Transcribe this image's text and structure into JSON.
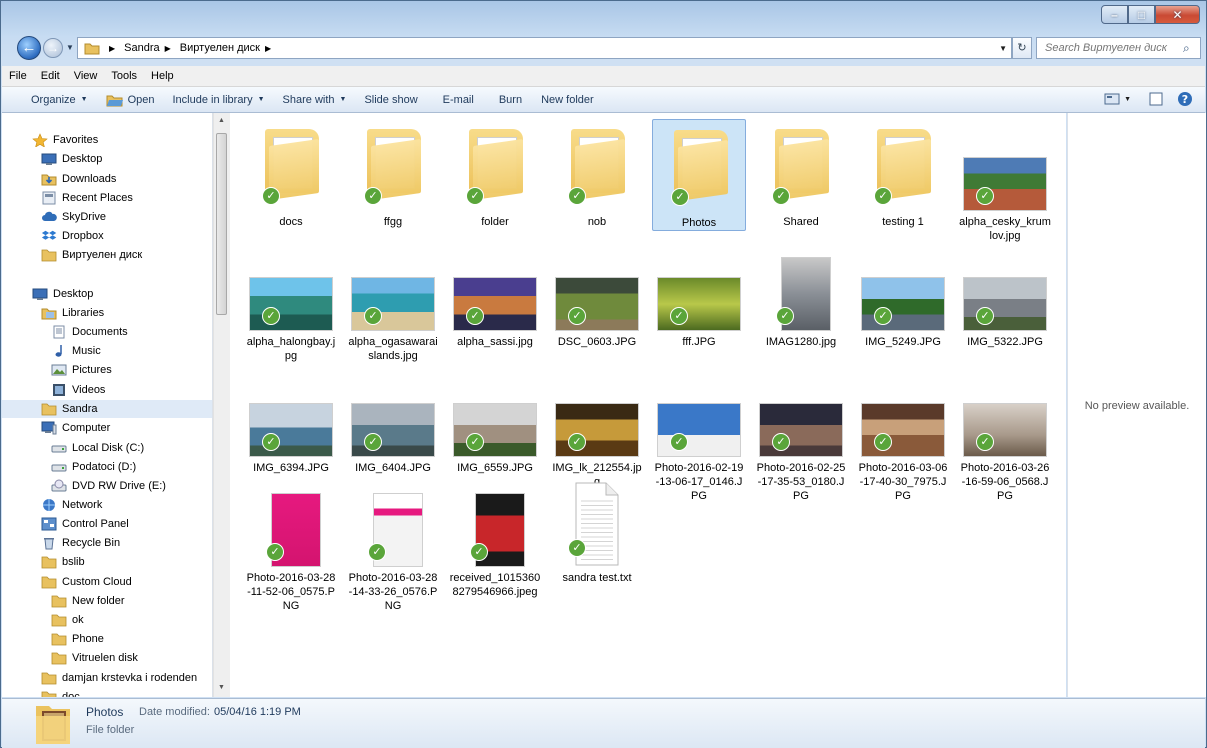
{
  "window": {
    "minimize_label": "–",
    "maximize_label": "□",
    "close_label": "✕"
  },
  "address": {
    "crumbs": [
      "Sandra",
      "Виртуелен диск"
    ],
    "search_placeholder": "Search Виртуелен диск"
  },
  "menu": [
    "File",
    "Edit",
    "View",
    "Tools",
    "Help"
  ],
  "toolbar": {
    "organize": "Organize",
    "open": "Open",
    "include": "Include in library",
    "share": "Share with",
    "slideshow": "Slide show",
    "email": "E-mail",
    "burn": "Burn",
    "new_folder": "New folder"
  },
  "nav": [
    {
      "label": "Favorites",
      "icon": "star-icon"
    },
    {
      "label": "Desktop",
      "icon": "desktop-icon"
    },
    {
      "label": "Downloads",
      "icon": "downloads-icon"
    },
    {
      "label": "Recent Places",
      "icon": "recent-places-icon"
    },
    {
      "label": "SkyDrive",
      "icon": "skydrive-icon"
    },
    {
      "label": "Dropbox",
      "icon": "dropbox-icon"
    },
    {
      "label": "Виртуелен диск",
      "icon": "folder-icon"
    },
    {
      "label": "Desktop",
      "icon": "desktop-icon"
    },
    {
      "label": "Libraries",
      "icon": "libraries-icon"
    },
    {
      "label": "Documents",
      "icon": "documents-icon"
    },
    {
      "label": "Music",
      "icon": "music-icon"
    },
    {
      "label": "Pictures",
      "icon": "pictures-icon"
    },
    {
      "label": "Videos",
      "icon": "videos-icon"
    },
    {
      "label": "Sandra",
      "icon": "folder-icon"
    },
    {
      "label": "Computer",
      "icon": "computer-icon"
    },
    {
      "label": "Local Disk (C:)",
      "icon": "drive-icon"
    },
    {
      "label": "Podatoci (D:)",
      "icon": "drive-icon"
    },
    {
      "label": "DVD RW Drive (E:)",
      "icon": "dvd-drive-icon"
    },
    {
      "label": "Network",
      "icon": "network-icon"
    },
    {
      "label": "Control Panel",
      "icon": "control-panel-icon"
    },
    {
      "label": "Recycle Bin",
      "icon": "recycle-bin-icon"
    },
    {
      "label": "bslib",
      "icon": "folder-icon"
    },
    {
      "label": "Custom Cloud",
      "icon": "folder-icon"
    },
    {
      "label": "New folder",
      "icon": "folder-icon"
    },
    {
      "label": "ok",
      "icon": "folder-icon"
    },
    {
      "label": "Phone",
      "icon": "folder-icon"
    },
    {
      "label": "Vitruelen disk",
      "icon": "folder-icon"
    },
    {
      "label": "damjan krstevka i rodenden",
      "icon": "folder-icon"
    },
    {
      "label": "doc",
      "icon": "folder-icon"
    }
  ],
  "files": [
    {
      "label": "docs",
      "kind": "folder"
    },
    {
      "label": "ffgg",
      "kind": "folder"
    },
    {
      "label": "folder",
      "kind": "folder"
    },
    {
      "label": "nob",
      "kind": "folder"
    },
    {
      "label": "Photos",
      "kind": "folder"
    },
    {
      "label": "Shared",
      "kind": "folder"
    },
    {
      "label": "testing 1",
      "kind": "folder"
    },
    {
      "label": "alpha_cesky_krumlov.jpg",
      "kind": "image"
    },
    {
      "label": "alpha_halongbay.jpg",
      "kind": "image"
    },
    {
      "label": "alpha_ogasawaraislands.jpg",
      "kind": "image"
    },
    {
      "label": "alpha_sassi.jpg",
      "kind": "image"
    },
    {
      "label": "DSC_0603.JPG",
      "kind": "image"
    },
    {
      "label": "fff.JPG",
      "kind": "image"
    },
    {
      "label": "IMAG1280.jpg",
      "kind": "image"
    },
    {
      "label": "IMG_5249.JPG",
      "kind": "image"
    },
    {
      "label": "IMG_5322.JPG",
      "kind": "image"
    },
    {
      "label": "IMG_6394.JPG",
      "kind": "image"
    },
    {
      "label": "IMG_6404.JPG",
      "kind": "image"
    },
    {
      "label": "IMG_6559.JPG",
      "kind": "image"
    },
    {
      "label": "IMG_lk_212554.jpg",
      "kind": "image"
    },
    {
      "label": "Photo-2016-02-19-13-06-17_0146.JPG",
      "kind": "image"
    },
    {
      "label": "Photo-2016-02-25-17-35-53_0180.JPG",
      "kind": "image"
    },
    {
      "label": "Photo-2016-03-06-17-40-30_7975.JPG",
      "kind": "image"
    },
    {
      "label": "Photo-2016-03-26-16-59-06_0568.JPG",
      "kind": "image"
    },
    {
      "label": "Photo-2016-03-28-11-52-06_0575.PNG",
      "kind": "image"
    },
    {
      "label": "Photo-2016-03-28-14-33-26_0576.PNG",
      "kind": "image"
    },
    {
      "label": "received_10153608279546966.jpeg",
      "kind": "image"
    },
    {
      "label": "sandra test.txt",
      "kind": "text"
    }
  ],
  "preview": {
    "message": "No preview available."
  },
  "details": {
    "name": "Photos",
    "modified_label": "Date modified:",
    "modified_value": "05/04/16 1:19 PM",
    "type": "File folder"
  }
}
